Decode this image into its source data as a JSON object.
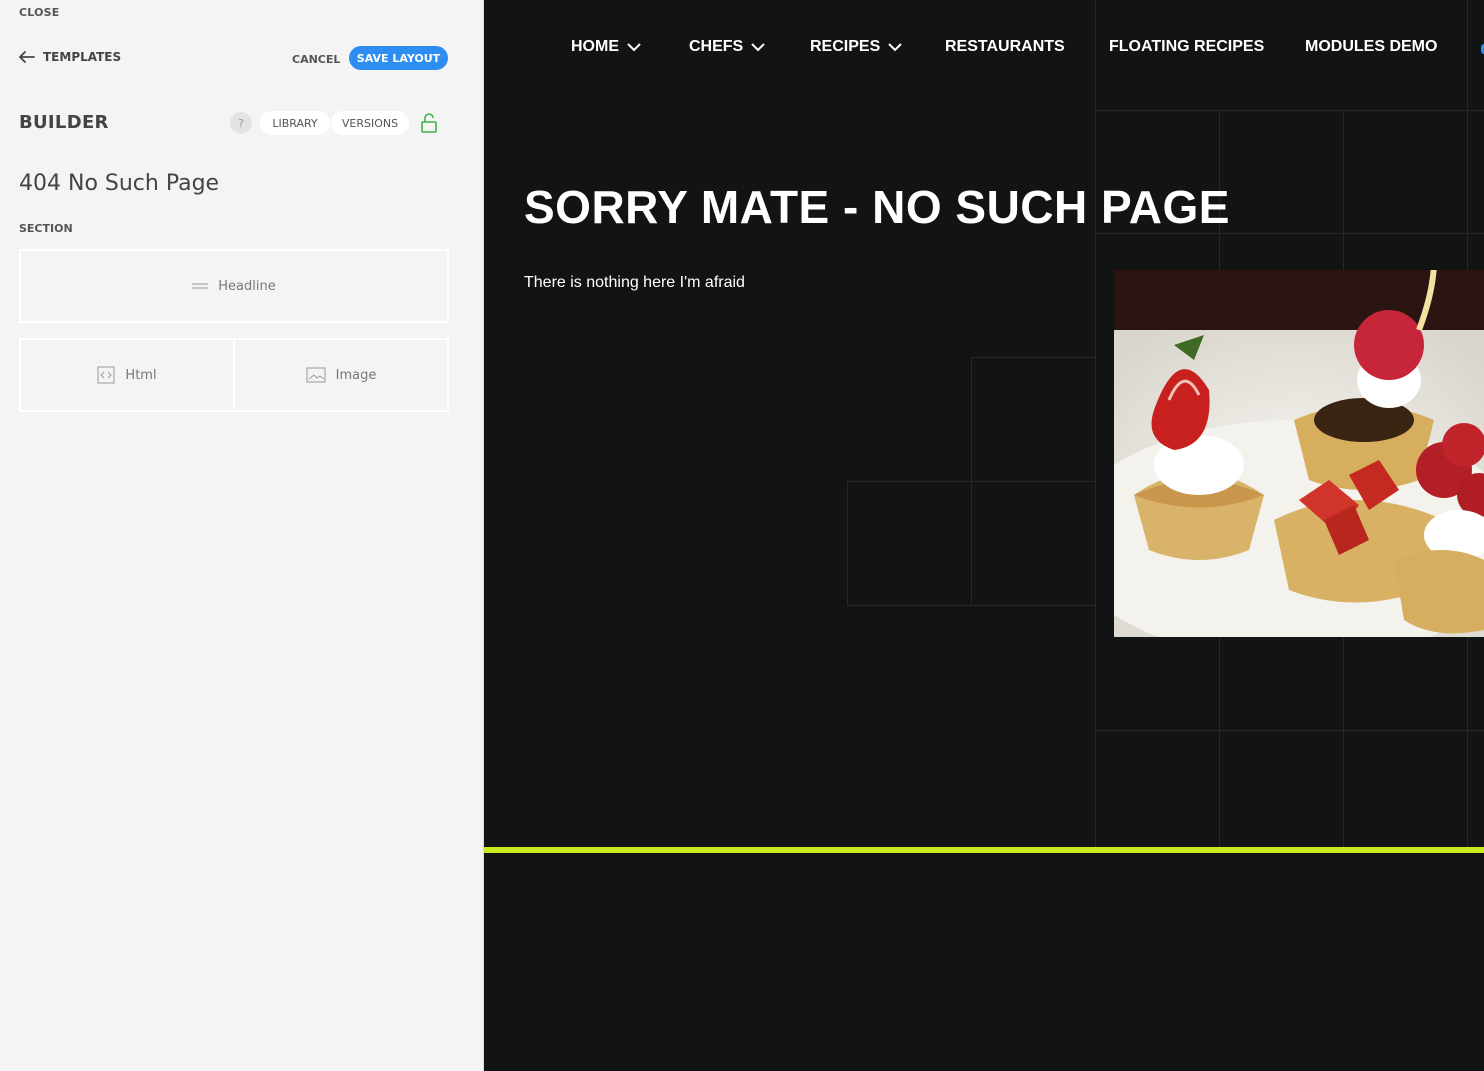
{
  "builder": {
    "close_label": "CLOSE",
    "templates_label": "TEMPLATES",
    "cancel_label": "CANCEL",
    "save_label": "SAVE LAYOUT",
    "title": "BUILDER",
    "help_label": "?",
    "library_label": "LIBRARY",
    "versions_label": "VERSIONS",
    "page_name": "404 No Such Page",
    "section_label": "SECTION",
    "blocks": [
      {
        "label": "Headline",
        "icon": "headline-icon"
      },
      {
        "label": "Html",
        "icon": "code-icon"
      },
      {
        "label": "Image",
        "icon": "image-icon"
      }
    ],
    "colors": {
      "accent": "#2e8df0",
      "lock": "#3cb34a",
      "panel_bg": "#f4f4f4"
    }
  },
  "preview": {
    "nav": [
      {
        "label": "HOME",
        "has_dropdown": true
      },
      {
        "label": "CHEFS",
        "has_dropdown": true
      },
      {
        "label": "RECIPES",
        "has_dropdown": true
      },
      {
        "label": "RESTAURANTS",
        "has_dropdown": false
      },
      {
        "label": "FLOATING RECIPES",
        "has_dropdown": false
      },
      {
        "label": "MODULES DEMO",
        "has_dropdown": false
      }
    ],
    "headline": "SORRY MATE - NO SUCH PAGE",
    "body": "There is nothing here I'm afraid",
    "colors": {
      "background": "#121313",
      "accent_bar": "#c9ea1f"
    }
  }
}
